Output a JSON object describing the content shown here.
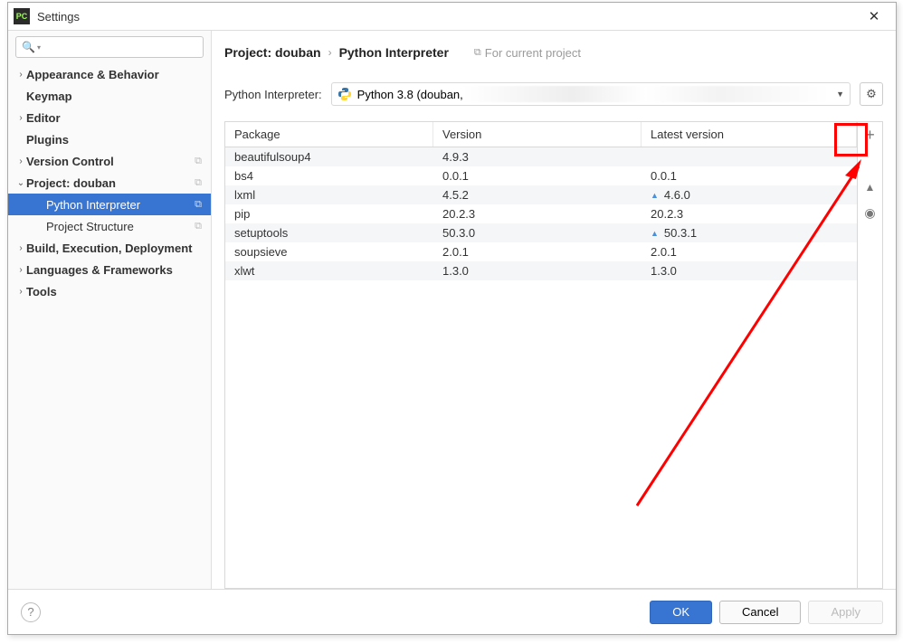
{
  "titlebar": {
    "title": "Settings"
  },
  "tree": [
    {
      "label": "Appearance & Behavior",
      "level": 1,
      "bold": true,
      "arrow": "right"
    },
    {
      "label": "Keymap",
      "level": 1,
      "bold": true,
      "arrow": "none"
    },
    {
      "label": "Editor",
      "level": 1,
      "bold": true,
      "arrow": "right"
    },
    {
      "label": "Plugins",
      "level": 1,
      "bold": true,
      "arrow": "none"
    },
    {
      "label": "Version Control",
      "level": 1,
      "bold": true,
      "arrow": "right",
      "copy": true
    },
    {
      "label": "Project: douban",
      "level": 1,
      "bold": true,
      "arrow": "down",
      "copy": true
    },
    {
      "label": "Python Interpreter",
      "level": 2,
      "bold": false,
      "arrow": "none",
      "copy": true,
      "selected": true
    },
    {
      "label": "Project Structure",
      "level": 2,
      "bold": false,
      "arrow": "none",
      "copy": true
    },
    {
      "label": "Build, Execution, Deployment",
      "level": 1,
      "bold": true,
      "arrow": "right"
    },
    {
      "label": "Languages & Frameworks",
      "level": 1,
      "bold": true,
      "arrow": "right"
    },
    {
      "label": "Tools",
      "level": 1,
      "bold": true,
      "arrow": "right"
    }
  ],
  "breadcrumb": {
    "project": "Project: douban",
    "page": "Python Interpreter",
    "tag": "For current project"
  },
  "interpreter": {
    "label": "Python Interpreter:",
    "value": "Python 3.8 (douban,"
  },
  "table": {
    "headers": {
      "pkg": "Package",
      "ver": "Version",
      "lat": "Latest version"
    },
    "rows": [
      {
        "pkg": "beautifulsoup4",
        "ver": "4.9.3",
        "lat": "",
        "up": false
      },
      {
        "pkg": "bs4",
        "ver": "0.0.1",
        "lat": "0.0.1",
        "up": false
      },
      {
        "pkg": "lxml",
        "ver": "4.5.2",
        "lat": "4.6.0",
        "up": true
      },
      {
        "pkg": "pip",
        "ver": "20.2.3",
        "lat": "20.2.3",
        "up": false
      },
      {
        "pkg": "setuptools",
        "ver": "50.3.0",
        "lat": "50.3.1",
        "up": true
      },
      {
        "pkg": "soupsieve",
        "ver": "2.0.1",
        "lat": "2.0.1",
        "up": false
      },
      {
        "pkg": "xlwt",
        "ver": "1.3.0",
        "lat": "1.3.0",
        "up": false
      }
    ]
  },
  "footer": {
    "ok": "OK",
    "cancel": "Cancel",
    "apply": "Apply"
  }
}
